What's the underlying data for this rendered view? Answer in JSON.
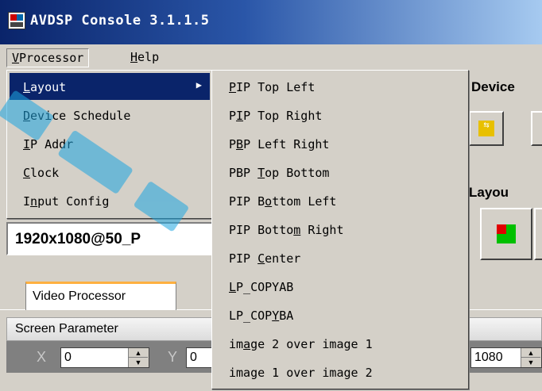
{
  "window": {
    "title": "AVDSP Console 3.1.1.5"
  },
  "menubar": {
    "items": [
      {
        "label": "VProcessor",
        "mnemonic": "V",
        "rest": "Processor"
      },
      {
        "label": "Help",
        "mnemonic": "H",
        "rest": "elp"
      }
    ]
  },
  "vprocessor_menu": {
    "items": [
      {
        "pre": "",
        "mn": "L",
        "post": "ayout",
        "has_submenu": true,
        "selected": true
      },
      {
        "pre": "",
        "mn": "D",
        "post": "evice Schedule"
      },
      {
        "pre": "",
        "mn": "I",
        "post": "P Addr"
      },
      {
        "pre": "",
        "mn": "C",
        "post": "lock"
      },
      {
        "pre": "I",
        "mn": "n",
        "post": "put Config"
      }
    ]
  },
  "layout_submenu": {
    "items": [
      {
        "pre": "",
        "mn": "P",
        "post": "IP Top Left"
      },
      {
        "pre": "P",
        "mn": "I",
        "post": "P Top Right"
      },
      {
        "pre": "P",
        "mn": "B",
        "post": "P Left Right"
      },
      {
        "pre": "PBP ",
        "mn": "T",
        "post": "op Bottom"
      },
      {
        "pre": "PIP B",
        "mn": "o",
        "post": "ttom Left"
      },
      {
        "pre": "PIP Botto",
        "mn": "m",
        "post": " Right"
      },
      {
        "pre": "PIP ",
        "mn": "C",
        "post": "enter"
      },
      {
        "pre": "",
        "mn": "L",
        "post": "P_COPYAB"
      },
      {
        "pre": "LP_COP",
        "mn": "Y",
        "post": "BA"
      },
      {
        "pre": "im",
        "mn": "a",
        "post": "ge 2 over image 1"
      },
      {
        "pre": "image 1 over image 2",
        "mn": "",
        "post": ""
      }
    ]
  },
  "main": {
    "device_group_title": "Device",
    "layout_group_title": "Layou",
    "resolution_value": "1920x1080@50_P",
    "tab_label": "Video Processor",
    "screen_parameter_label": "Screen Parameter",
    "x_label": "X",
    "x_value": "0",
    "y_label": "Y",
    "y_value": "0",
    "height_value": "1080"
  },
  "icons": {
    "app": "app-icon",
    "swap": "swap-arrows-icon",
    "layout": "pip-layout-icon",
    "submenu_arrow": "triangle-right-icon"
  },
  "colors": {
    "menu_highlight": "#0a246a",
    "title_gradient_start": "#0a246a",
    "title_gradient_end": "#a6caf0",
    "tab_accent": "#ffb040"
  }
}
